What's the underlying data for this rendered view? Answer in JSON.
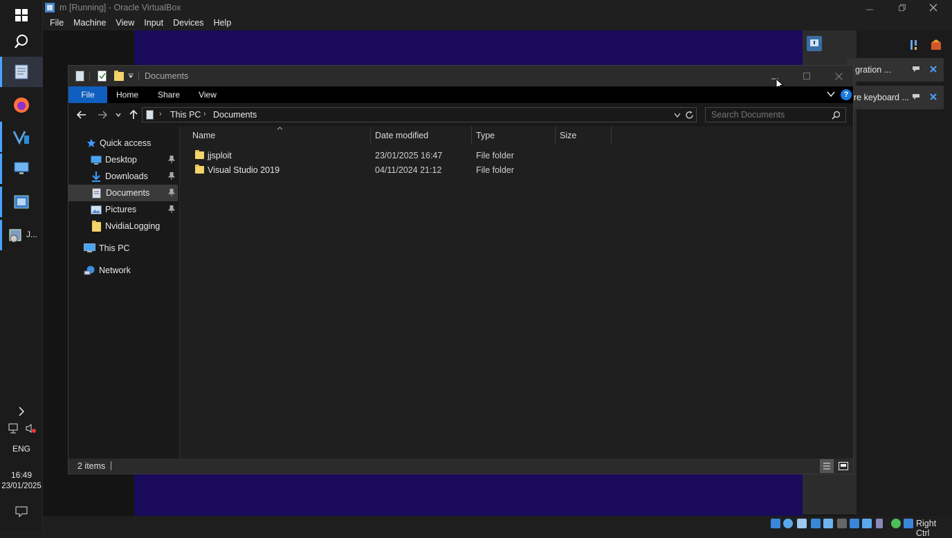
{
  "vbox": {
    "title": "m [Running] - Oracle VirtualBox",
    "menu": [
      "File",
      "Machine",
      "View",
      "Input",
      "Devices",
      "Help"
    ],
    "host_key": "Right Ctrl"
  },
  "host_taskbar": {
    "pinned_label": "J...",
    "language": "ENG",
    "time": "16:49",
    "date": "23/01/2025"
  },
  "notifications": [
    {
      "text": "gration ..."
    },
    {
      "text": "re keyboard ..."
    }
  ],
  "explorer": {
    "title": "Documents",
    "ribbon_tabs": [
      "File",
      "Home",
      "Share",
      "View"
    ],
    "breadcrumb": [
      "This PC",
      "Documents"
    ],
    "search_placeholder": "Search Documents",
    "nav": {
      "quick_access": "Quick access",
      "pinned": [
        "Desktop",
        "Downloads",
        "Documents",
        "Pictures"
      ],
      "other": "NvidiaLogging",
      "this_pc": "This PC",
      "network": "Network"
    },
    "columns": [
      "Name",
      "Date modified",
      "Type",
      "Size"
    ],
    "rows": [
      {
        "name": "jjsploit",
        "date": "23/01/2025 16:47",
        "type": "File folder",
        "size": ""
      },
      {
        "name": "Visual Studio 2019",
        "date": "04/11/2024 21:12",
        "type": "File folder",
        "size": ""
      }
    ],
    "status": "2 items"
  },
  "colors": {
    "accent": "#0e5fbf",
    "vm_bg": "#1a0a5c"
  }
}
